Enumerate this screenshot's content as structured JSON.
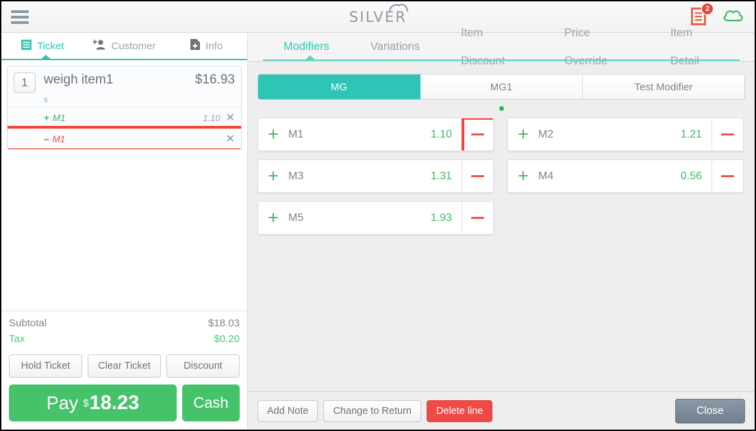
{
  "topbar": {
    "menu_icon": "hamburger-menu-icon",
    "logo_text": "SILVER",
    "logo_cloud_icon": "cloud-arc-icon",
    "receipt_icon": "receipt-icon",
    "receipt_badge_count": "2",
    "cloud_icon": "cloud-sync-icon",
    "receipt_color": "#e8644a",
    "cloud_color": "#3fb863",
    "badge_color": "#e8443a"
  },
  "left_panel": {
    "tabs": [
      {
        "label": "Ticket",
        "icon": "ticket-list-icon",
        "active": true
      },
      {
        "label": "Customer",
        "icon": "add-person-icon",
        "active": false
      },
      {
        "label": "Info",
        "icon": "add-document-icon",
        "active": false
      }
    ],
    "ticket": {
      "quantity": "1",
      "name": "weigh item1",
      "price": "$16.93",
      "sub_label": "s",
      "modifiers": [
        {
          "sign": "+",
          "name": "M1",
          "amount": "1.10",
          "remove_icon": "close-x-icon",
          "type": "add",
          "highlighted": false
        },
        {
          "sign": "–",
          "name": "M1",
          "amount": "",
          "remove_icon": "close-x-icon",
          "type": "remove",
          "highlighted": true
        }
      ]
    },
    "totals": [
      {
        "label": "Subtotal",
        "value": "$18.03",
        "accent": false
      },
      {
        "label": "Tax",
        "value": "$0.20",
        "accent": true
      }
    ],
    "actions": [
      "Hold Ticket",
      "Clear Ticket",
      "Discount"
    ],
    "pay": {
      "label": "Pay",
      "currency": "$",
      "amount": "18.23",
      "cash_label": "Cash"
    }
  },
  "right_panel": {
    "tabs": [
      {
        "label": "Modifiers",
        "active": true
      },
      {
        "label": "Variations",
        "active": false
      },
      {
        "label": "Item Discount",
        "active": false
      },
      {
        "label": "Price Override",
        "active": false
      },
      {
        "label": "Item Detail",
        "active": false
      }
    ],
    "group_tabs": [
      {
        "label": "MG",
        "active": true
      },
      {
        "label": "MG1",
        "active": false
      },
      {
        "label": "Test Modifier",
        "active": false
      }
    ],
    "page_dots": 1,
    "modifiers": [
      {
        "name": "M1",
        "price": "1.10",
        "add_icon": "plus-icon",
        "remove_icon": "minus-icon",
        "highlighted": true
      },
      {
        "name": "M2",
        "price": "1.21",
        "add_icon": "plus-icon",
        "remove_icon": "minus-icon",
        "highlighted": false
      },
      {
        "name": "M3",
        "price": "1.31",
        "add_icon": "plus-icon",
        "remove_icon": "minus-icon",
        "highlighted": false
      },
      {
        "name": "M4",
        "price": "0.56",
        "add_icon": "plus-icon",
        "remove_icon": "minus-icon",
        "highlighted": false
      },
      {
        "name": "M5",
        "price": "1.93",
        "add_icon": "plus-icon",
        "remove_icon": "minus-icon",
        "highlighted": false
      }
    ],
    "footer": {
      "add_note": "Add Note",
      "change_to_return": "Change to Return",
      "delete_line": "Delete line",
      "close": "Close"
    }
  },
  "colors": {
    "teal": "#35c5b4",
    "green": "#3fb863",
    "red": "#f0534a",
    "highlight": "#f44336",
    "gray_text": "#7c858c"
  }
}
